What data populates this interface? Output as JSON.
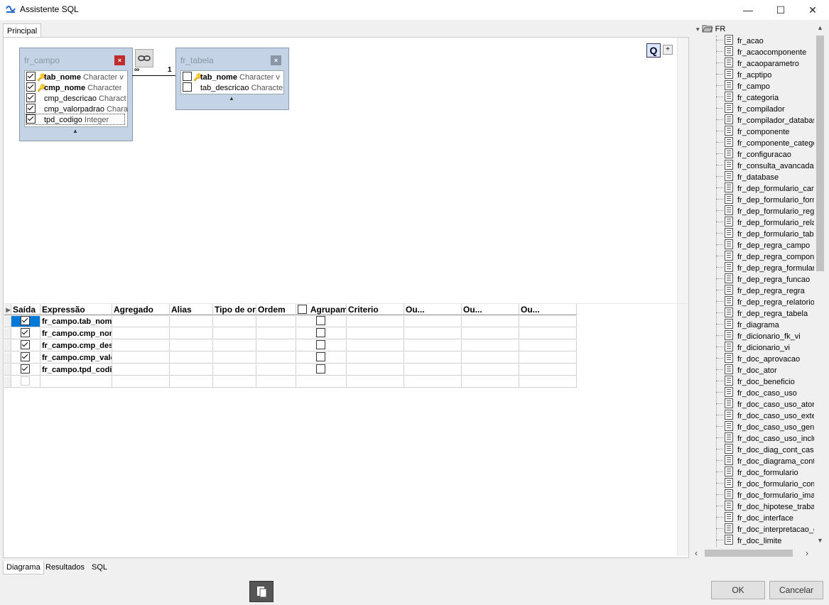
{
  "window": {
    "title": "Assistente SQL",
    "minimize": "—",
    "maximize": "☐",
    "close": "✕"
  },
  "tabs": {
    "principal": "Principal"
  },
  "diagram": {
    "query_btn": "Q",
    "plus_btn": "+",
    "link_label_left": "∞",
    "link_label_right": "1",
    "tables": [
      {
        "name": "fr_campo",
        "close": "×",
        "fields": [
          {
            "checked": true,
            "key": true,
            "name": "tab_nome",
            "bold": true,
            "type": "Character v"
          },
          {
            "checked": true,
            "key": true,
            "name": "cmp_nome",
            "bold": true,
            "type": "Character"
          },
          {
            "checked": true,
            "key": false,
            "name": "cmp_descricao",
            "bold": false,
            "type": "Charact"
          },
          {
            "checked": true,
            "key": false,
            "name": "cmp_valorpadrao",
            "bold": false,
            "type": "Chara"
          },
          {
            "checked": true,
            "key": false,
            "name": "tpd_codigo",
            "bold": false,
            "type": "Integer"
          }
        ],
        "footer": "▲"
      },
      {
        "name": "fr_tabela",
        "close": "×",
        "fields": [
          {
            "checked": false,
            "key": true,
            "name": "tab_nome",
            "bold": true,
            "type": "Character v"
          },
          {
            "checked": false,
            "key": false,
            "name": "tab_descricao",
            "bold": false,
            "type": "Characte"
          }
        ],
        "footer": "▲"
      }
    ]
  },
  "grid": {
    "indicator": "▸",
    "headers": [
      "Saída",
      "Expressão",
      "Agregado",
      "Alias",
      "Tipo de ordem",
      "Ordem",
      "Agrupamento",
      "Criterio",
      "Ou...",
      "Ou...",
      "Ou..."
    ],
    "rows": [
      {
        "saida": true,
        "expr": "fr_campo.tab_nome",
        "agrupar": false
      },
      {
        "saida": true,
        "expr": "fr_campo.cmp_nome",
        "agrupar": false
      },
      {
        "saida": true,
        "expr": "fr_campo.cmp_descricao",
        "agrupar": false
      },
      {
        "saida": true,
        "expr": "fr_campo.cmp_valorpadrao",
        "agrupar": false
      },
      {
        "saida": true,
        "expr": "fr_campo.tpd_codigo",
        "agrupar": false
      }
    ]
  },
  "tree": {
    "root": "FR",
    "items": [
      "fr_acao",
      "fr_acaocomponente",
      "fr_acaoparametro",
      "fr_acptipo",
      "fr_campo",
      "fr_categoria",
      "fr_compilador",
      "fr_compilador_database",
      "fr_componente",
      "fr_componente_categoria",
      "fr_configuracao",
      "fr_consulta_avancada",
      "fr_database",
      "fr_dep_formulario_campo",
      "fr_dep_formulario_formulario",
      "fr_dep_formulario_regra",
      "fr_dep_formulario_relatorio",
      "fr_dep_formulario_tabela",
      "fr_dep_regra_campo",
      "fr_dep_regra_componente",
      "fr_dep_regra_formulario",
      "fr_dep_regra_funcao",
      "fr_dep_regra_regra",
      "fr_dep_regra_relatorio",
      "fr_dep_regra_tabela",
      "fr_diagrama",
      "fr_dicionario_fk_vi",
      "fr_dicionario_vi",
      "fr_doc_aprovacao",
      "fr_doc_ator",
      "fr_doc_beneficio",
      "fr_doc_caso_uso",
      "fr_doc_caso_uso_ator",
      "fr_doc_caso_uso_extends",
      "fr_doc_caso_uso_generalizacao",
      "fr_doc_caso_uso_include",
      "fr_doc_diag_cont_caso",
      "fr_doc_diagrama_contexto",
      "fr_doc_formulario",
      "fr_doc_formulario_comando",
      "fr_doc_formulario_imagem",
      "fr_doc_hipotese_trabalho",
      "fr_doc_interface",
      "fr_doc_interpretacao_dados",
      "fr_doc_limite"
    ]
  },
  "bottom_tabs": [
    "Diagrama",
    "Resultados",
    "SQL"
  ],
  "buttons": {
    "ok": "OK",
    "cancel": "Cancelar"
  }
}
